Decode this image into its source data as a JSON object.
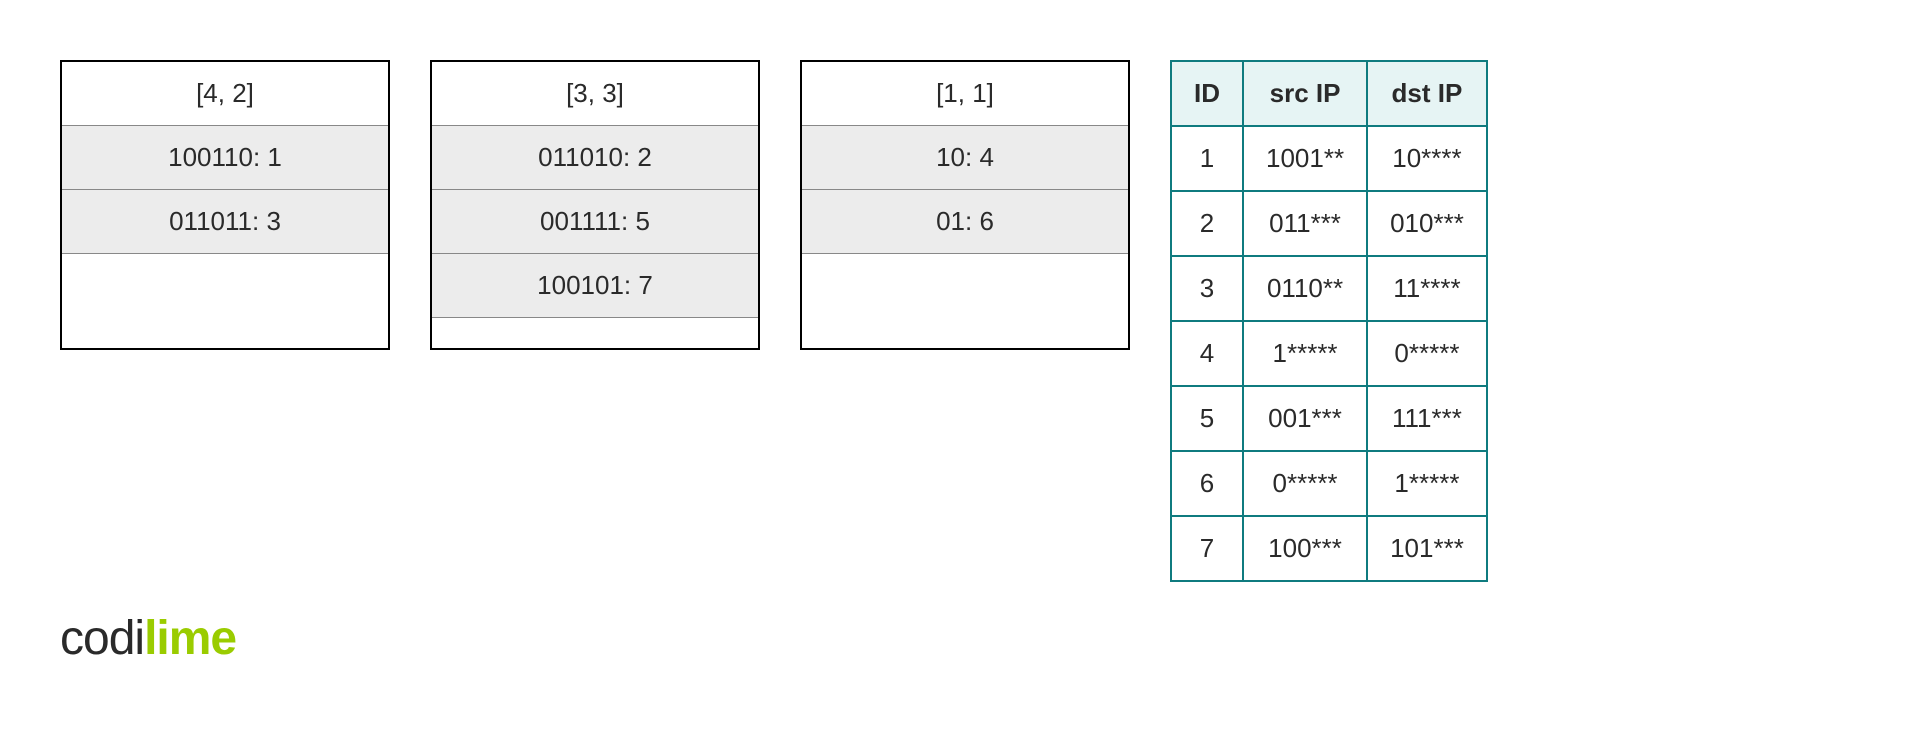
{
  "buckets": [
    {
      "header": "[4, 2]",
      "rows": [
        "100110: 1",
        "011011: 3"
      ]
    },
    {
      "header": "[3, 3]",
      "rows": [
        "011010: 2",
        "001111: 5",
        "100101: 7"
      ]
    },
    {
      "header": "[1, 1]",
      "rows": [
        "10: 4",
        "01: 6"
      ]
    }
  ],
  "rules": {
    "headers": {
      "id": "ID",
      "src": "src IP",
      "dst": "dst IP"
    },
    "rows": [
      {
        "id": "1",
        "src": "1001**",
        "dst": "10****"
      },
      {
        "id": "2",
        "src": "011***",
        "dst": "010***"
      },
      {
        "id": "3",
        "src": "0110**",
        "dst": "11****"
      },
      {
        "id": "4",
        "src": "1*****",
        "dst": "0*****"
      },
      {
        "id": "5",
        "src": "001***",
        "dst": "111***"
      },
      {
        "id": "6",
        "src": "0*****",
        "dst": "1*****"
      },
      {
        "id": "7",
        "src": "100***",
        "dst": "101***"
      }
    ]
  },
  "logo": {
    "part1": "codi",
    "part2": "lime"
  }
}
